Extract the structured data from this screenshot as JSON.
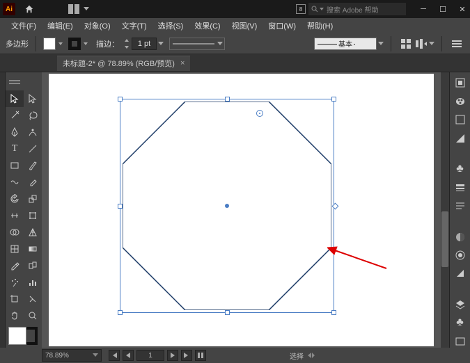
{
  "app": {
    "ai": "Ai"
  },
  "search": {
    "badge": "8",
    "placeholder": "搜索 Adobe 帮助"
  },
  "menu": {
    "file": "文件(F)",
    "edit": "编辑(E)",
    "object": "对象(O)",
    "type": "文字(T)",
    "select": "选择(S)",
    "effect": "效果(C)",
    "view": "视图(V)",
    "window": "窗口(W)",
    "help": "帮助(H)"
  },
  "control": {
    "shape": "多边形",
    "stroke_label": "描边：",
    "stroke_pt": "1 pt",
    "style_label": "基本"
  },
  "doc": {
    "tab": "未标题-2* @ 78.89% (RGB/预览)",
    "close": "×"
  },
  "status": {
    "zoom": "78.89%",
    "page": "1",
    "mode": "选择"
  }
}
